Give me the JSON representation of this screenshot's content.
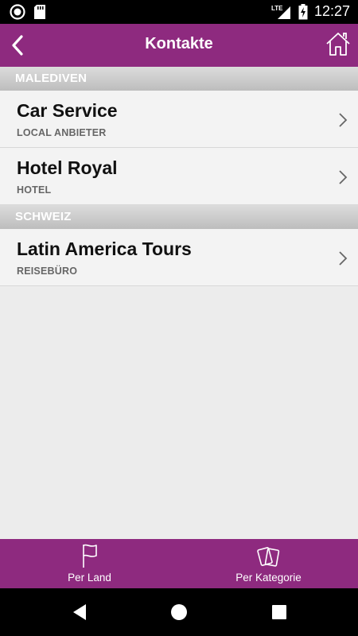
{
  "status_bar": {
    "time": "12:27",
    "network": "LTE",
    "icons": [
      "record-icon",
      "sd-card-icon",
      "signal-icon",
      "battery-charging-icon"
    ]
  },
  "app_bar": {
    "title": "Kontakte",
    "back_icon": "chevron-left-icon",
    "home_icon": "home-icon"
  },
  "sections": [
    {
      "header": "MALEDIVEN",
      "items": [
        {
          "name": "Car Service",
          "category": "LOCAL ANBIETER"
        },
        {
          "name": "Hotel Royal",
          "category": "HOTEL"
        }
      ]
    },
    {
      "header": "SCHWEIZ",
      "items": [
        {
          "name": "Latin America Tours",
          "category": "REISEBÜRO"
        }
      ]
    }
  ],
  "bottom_tabs": [
    {
      "label": "Per Land",
      "icon": "flag-icon"
    },
    {
      "label": "Per Kategorie",
      "icon": "cards-icon"
    }
  ],
  "colors": {
    "brand": "#8e2a7f",
    "section_header": "#c4c4c4",
    "row_bg": "#f3f3f3",
    "content_bg": "#ececec"
  }
}
